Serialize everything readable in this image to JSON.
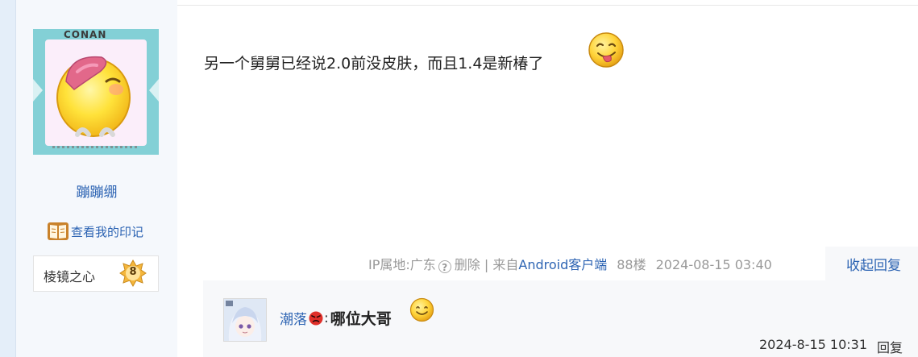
{
  "author": {
    "username": "蹦蹦绷",
    "avatar_brand": "CONAN",
    "imprint_label": "查看我的印记",
    "badge": {
      "name": "棱镜之心",
      "level": "8"
    }
  },
  "post": {
    "text": "另一个舅舅已经说2.0前没皮肤，而且1.4是新椿了",
    "emoji": "tongue-out-emoji"
  },
  "meta": {
    "ip_location": "IP属地:广东",
    "help_icon": "question-circle-icon",
    "delete": "删除",
    "separator": "|",
    "from_prefix": "来自",
    "client": "Android客户端",
    "floor": "88楼",
    "datetime": "2024-08-15 03:40"
  },
  "collapse_label": "收起回复",
  "reply": {
    "username": "潮落",
    "username_icon": "angry-face-icon",
    "colon": ":",
    "text": "哪位大哥",
    "emoji": "smile-emoji",
    "datetime": "2024-8-15 10:31",
    "reply_label": "回复"
  },
  "colors": {
    "link": "#2d64b3",
    "meta_gray": "#999999",
    "sidebar_bg": "#f5f8fc",
    "reply_bg": "#f7f8fa"
  }
}
